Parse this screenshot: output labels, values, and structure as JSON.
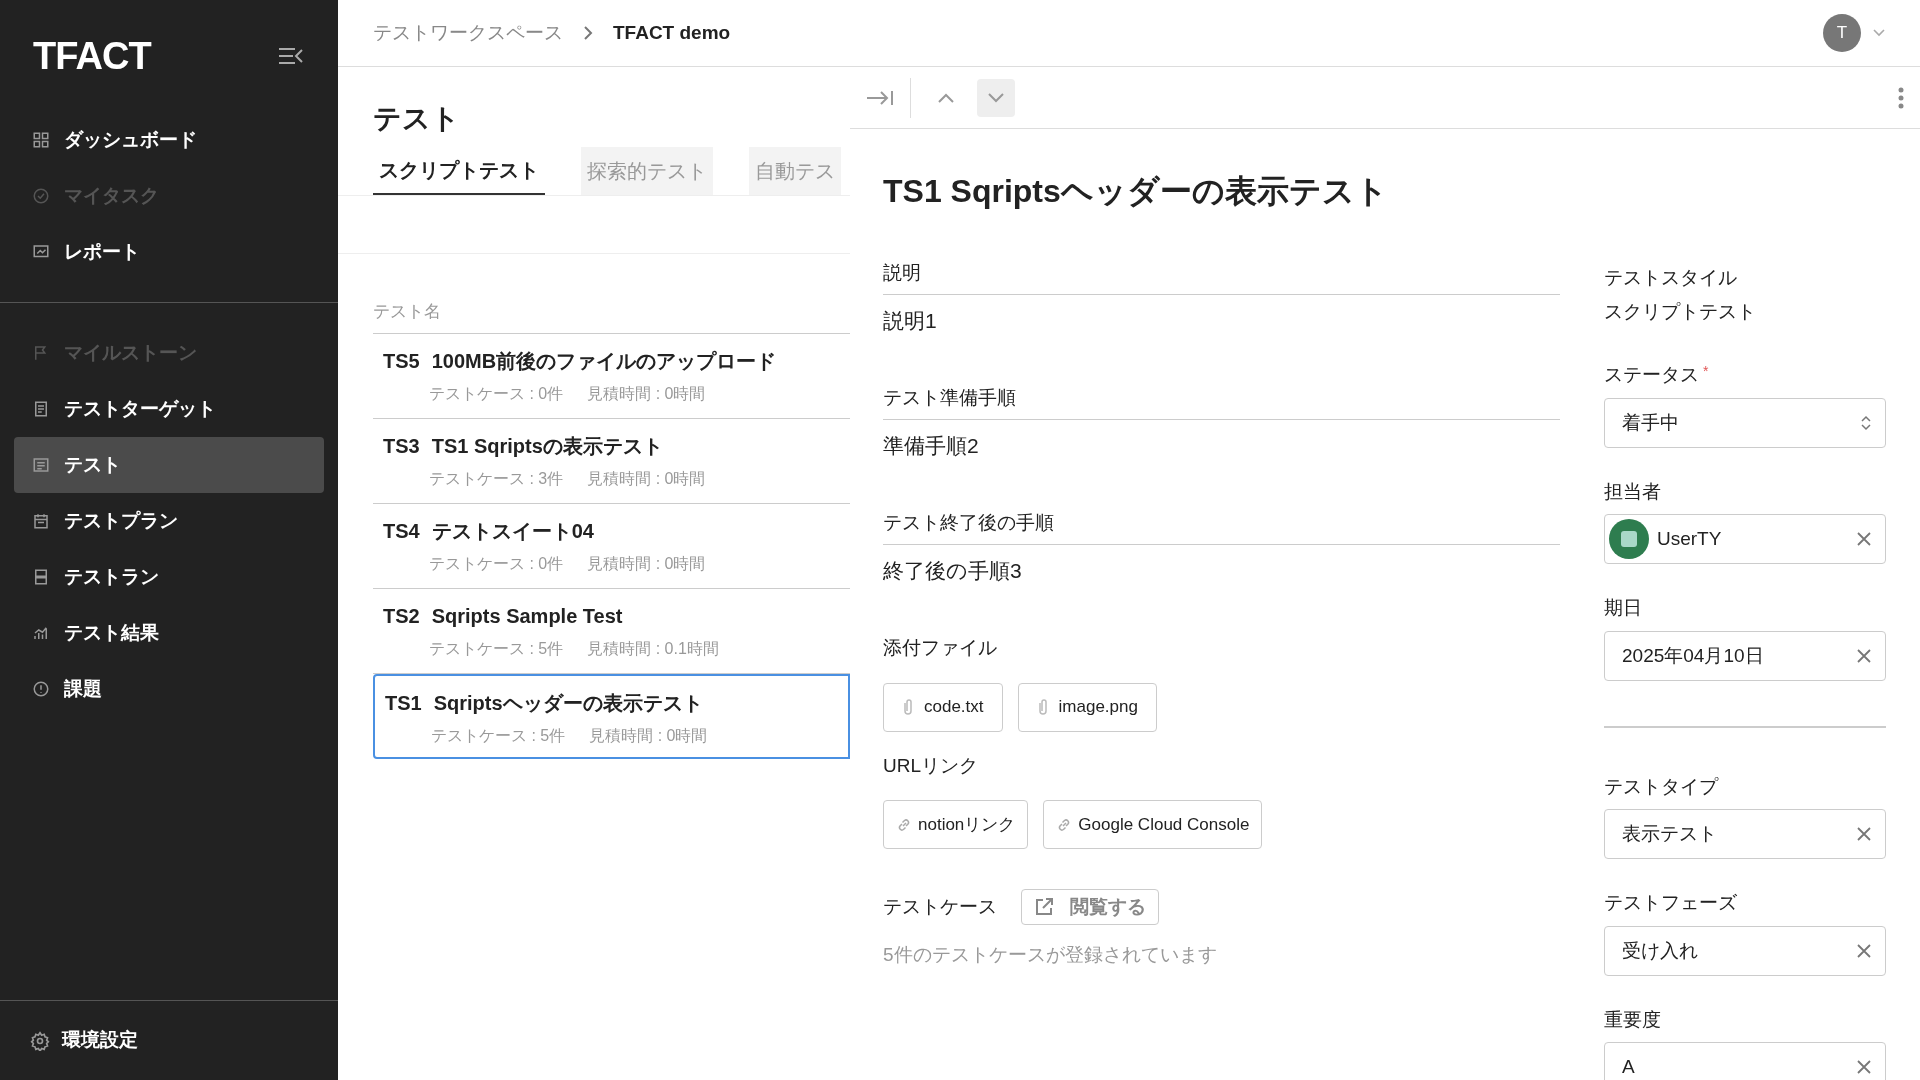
{
  "sidebar": {
    "logo": "TFACT",
    "groups": [
      [
        {
          "label": "ダッシュボード",
          "disabled": false,
          "selected": false
        },
        {
          "label": "マイタスク",
          "disabled": true,
          "selected": false
        },
        {
          "label": "レポート",
          "disabled": false,
          "selected": false
        }
      ],
      [
        {
          "label": "マイルストーン",
          "disabled": true,
          "selected": false
        },
        {
          "label": "テストターゲット",
          "disabled": false,
          "selected": false
        },
        {
          "label": "テスト",
          "disabled": false,
          "selected": true
        },
        {
          "label": "テストプラン",
          "disabled": false,
          "selected": false
        },
        {
          "label": "テストラン",
          "disabled": false,
          "selected": false
        },
        {
          "label": "テスト結果",
          "disabled": false,
          "selected": false
        },
        {
          "label": "課題",
          "disabled": false,
          "selected": false
        }
      ]
    ],
    "footer": {
      "label": "環境設定"
    }
  },
  "breadcrumb": [
    "テストワークスペース",
    "TFACT demo"
  ],
  "user_avatar": "T",
  "list_panel": {
    "title": "テスト",
    "tabs": [
      {
        "label": "スクリプトテスト",
        "selected": true
      },
      {
        "label": "探索的テスト",
        "selected": false
      },
      {
        "label": "自動テス",
        "selected": false
      }
    ],
    "column": "テスト名",
    "rows": [
      {
        "id": "TS5",
        "name": "100MB前後のファイルのアップロード",
        "cases": "テストケース : 0件",
        "estimate": "見積時間 : 0時間",
        "selected": false
      },
      {
        "id": "TS3",
        "name": "TS1 Sqriptsの表示テスト",
        "cases": "テストケース : 3件",
        "estimate": "見積時間 : 0時間",
        "selected": false
      },
      {
        "id": "TS4",
        "name": "テストスイート04",
        "cases": "テストケース : 0件",
        "estimate": "見積時間 : 0時間",
        "selected": false
      },
      {
        "id": "TS2",
        "name": "Sqripts Sample Test",
        "cases": "テストケース : 5件",
        "estimate": "見積時間 : 0.1時間",
        "selected": false
      },
      {
        "id": "TS1",
        "name": "Sqriptsヘッダーの表示テスト",
        "cases": "テストケース : 5件",
        "estimate": "見積時間 : 0時間",
        "selected": true
      }
    ]
  },
  "detail": {
    "title": "TS1 Sqriptsヘッダーの表示テスト",
    "sections": [
      {
        "label": "説明",
        "value": "説明1"
      },
      {
        "label": "テスト準備手順",
        "value": "準備手順2"
      },
      {
        "label": "テスト終了後の手順",
        "value": "終了後の手順3"
      }
    ],
    "attachments": {
      "label": "添付ファイル",
      "files": [
        "code.txt",
        "image.png"
      ]
    },
    "url_links": {
      "label": "URLリンク",
      "links": [
        "notionリンク",
        "Google Cloud Console"
      ]
    },
    "test_cases": {
      "label": "テストケース",
      "button": "閲覧する",
      "note": "5件のテストケースが登録されています"
    },
    "test_style": {
      "label": "テストスタイル",
      "value": "スクリプトテスト"
    },
    "fields": [
      {
        "kind": "select",
        "label": "ステータス",
        "required_mark": "*",
        "value": "着手中"
      },
      {
        "kind": "user",
        "label": "担当者",
        "value": "UserTY"
      },
      {
        "kind": "clearable",
        "label": "期日",
        "value": "2025年04月10日"
      }
    ],
    "classification_fields": [
      {
        "kind": "clearable",
        "label": "テストタイプ",
        "value": "表示テスト"
      },
      {
        "kind": "clearable",
        "label": "テストフェーズ",
        "value": "受け入れ"
      },
      {
        "kind": "clearable",
        "label": "重要度",
        "value": "A"
      }
    ]
  }
}
